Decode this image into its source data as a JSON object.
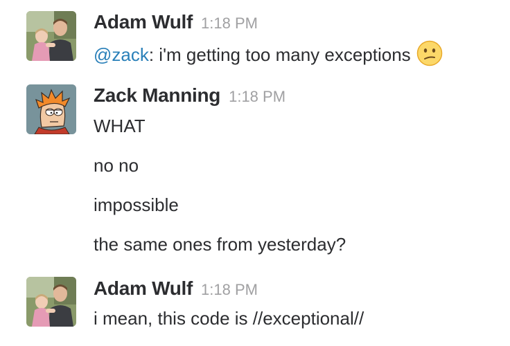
{
  "messages": [
    {
      "author": "Adam Wulf",
      "time": "1:18 PM",
      "avatar_icon": "family-photo-avatar",
      "lines": [
        {
          "mention": "@zack",
          "text": ": i'm getting too many exceptions",
          "emoji": "confused-face-emoji"
        }
      ]
    },
    {
      "author": "Zack Manning",
      "time": "1:18 PM",
      "avatar_icon": "cartoon-fry-avatar",
      "lines": [
        {
          "text": "WHAT"
        },
        {
          "text": "no no"
        },
        {
          "text": "impossible"
        },
        {
          "text": "the same ones from yesterday?"
        }
      ]
    },
    {
      "author": "Adam Wulf",
      "time": "1:18 PM",
      "avatar_icon": "family-photo-avatar",
      "lines": [
        {
          "text": "i mean, this code is //exceptional//"
        }
      ]
    }
  ],
  "colors": {
    "mention": "#2a80b9",
    "timestamp": "#a0a0a2",
    "text": "#2c2d30"
  }
}
